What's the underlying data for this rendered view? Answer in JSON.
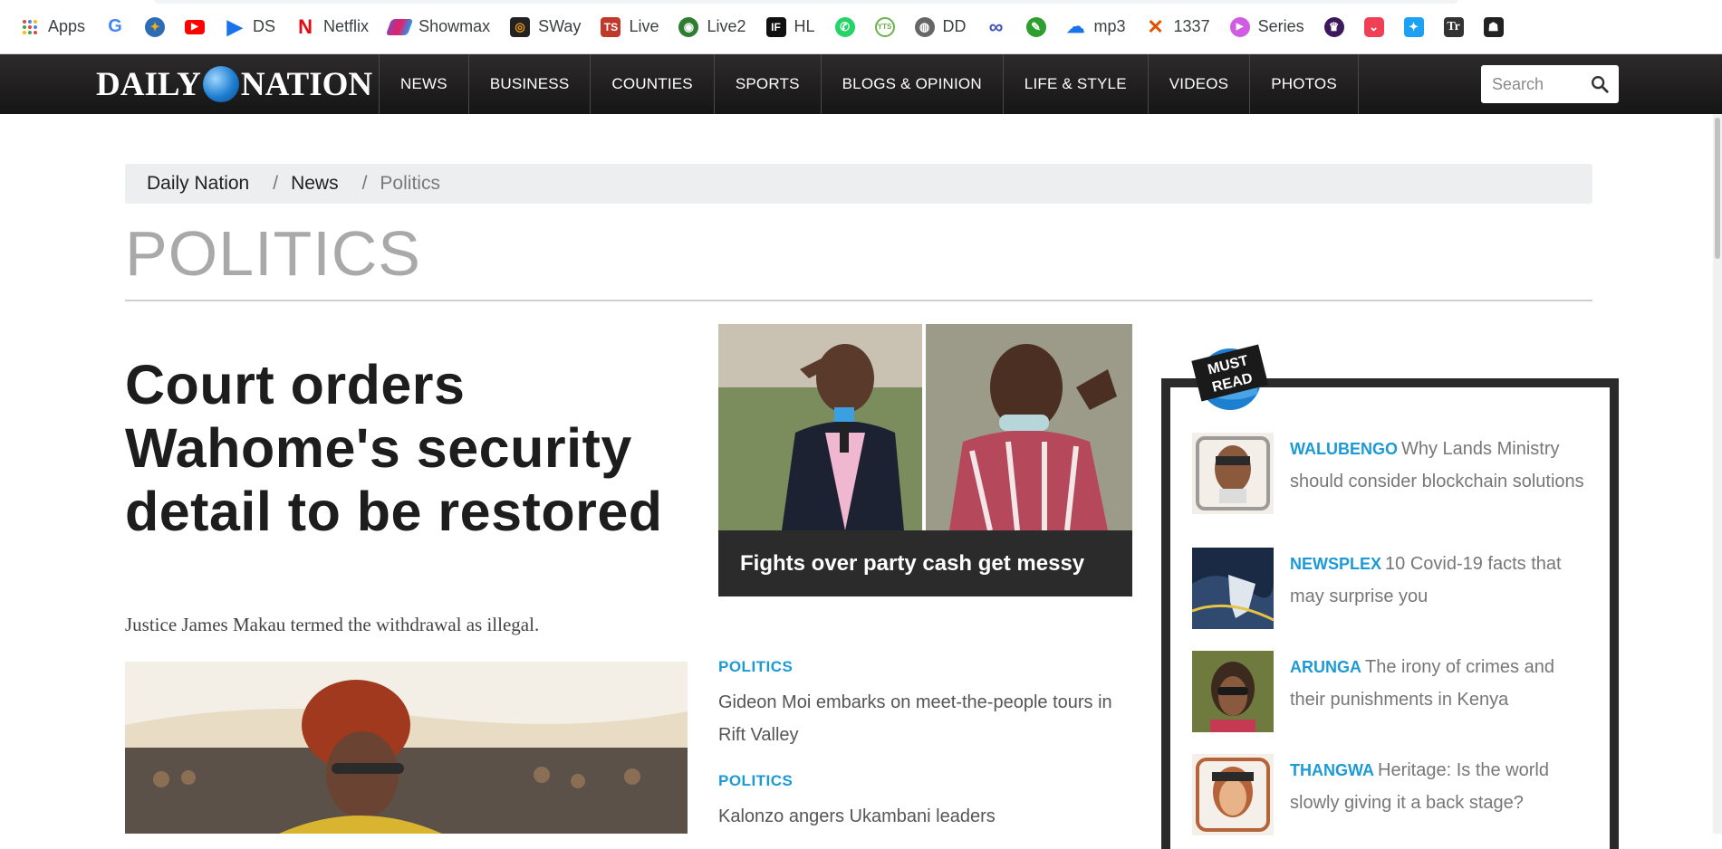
{
  "bookmarks": [
    {
      "label": "Apps",
      "icon": "apps-grid-icon"
    },
    {
      "label": "",
      "icon": "google-icon"
    },
    {
      "label": "",
      "icon": "compass-icon"
    },
    {
      "label": "",
      "icon": "youtube-icon"
    },
    {
      "label": "DS",
      "icon": "play-store-icon"
    },
    {
      "label": "Netflix",
      "icon": "netflix-icon"
    },
    {
      "label": "Showmax",
      "icon": "showmax-icon"
    },
    {
      "label": "SWay",
      "icon": "sway-icon"
    },
    {
      "label": "Live",
      "icon": "ts-icon"
    },
    {
      "label": "Live2",
      "icon": "live2-icon"
    },
    {
      "label": "HL",
      "icon": "hl-icon"
    },
    {
      "label": "",
      "icon": "whatsapp-icon"
    },
    {
      "label": "",
      "icon": "yts-icon"
    },
    {
      "label": "DD",
      "icon": "globe-icon"
    },
    {
      "label": "",
      "icon": "infinity-icon"
    },
    {
      "label": "",
      "icon": "edit-icon"
    },
    {
      "label": "mp3",
      "icon": "cloud-download-icon"
    },
    {
      "label": "1337",
      "icon": "x-icon"
    },
    {
      "label": "Series",
      "icon": "play-circle-icon"
    },
    {
      "label": "",
      "icon": "premier-league-icon"
    },
    {
      "label": "",
      "icon": "pocket-icon"
    },
    {
      "label": "",
      "icon": "twitter-icon"
    },
    {
      "label": "",
      "icon": "tr-icon"
    },
    {
      "label": "",
      "icon": "mask-icon"
    }
  ],
  "site": {
    "logo_left": "DAILY",
    "logo_right": "NATION"
  },
  "nav": {
    "items": [
      "NEWS",
      "BUSINESS",
      "COUNTIES",
      "SPORTS",
      "BLOGS & OPINION",
      "LIFE & STYLE",
      "VIDEOS",
      "PHOTOS"
    ],
    "search_placeholder": "Search"
  },
  "breadcrumb": {
    "home": "Daily Nation",
    "section": "News",
    "current": "Politics",
    "separator": "/"
  },
  "page": {
    "title": "POLITICS"
  },
  "lead": {
    "headline": "Court orders Wahome's security detail to be restored",
    "summary": "Justice James Makau termed the withdrawal as illegal."
  },
  "feature": {
    "caption": "Fights over party cash get messy"
  },
  "stories": [
    {
      "kicker": "POLITICS",
      "title": "Gideon Moi embarks on meet-the-people tours in Rift Valley"
    },
    {
      "kicker": "POLITICS",
      "title": "Kalonzo angers Ukambani leaders"
    }
  ],
  "must_read": {
    "badge_line1": "MUST",
    "badge_line2": "READ",
    "items": [
      {
        "author": "WALUBENGO",
        "title": "Why Lands Ministry should consider blockchain solutions"
      },
      {
        "author": "NEWSPLEX",
        "title": "10 Covid-19 facts that may surprise you"
      },
      {
        "author": "ARUNGA",
        "title": "The irony of crimes and their punishments in Kenya"
      },
      {
        "author": "THANGWA",
        "title": "Heritage: Is the world slowly giving it a back stage?"
      }
    ]
  },
  "colors": {
    "accent": "#1c9ad6",
    "navbar": "#1e1d1d",
    "title_gray": "#a9a9a9"
  }
}
